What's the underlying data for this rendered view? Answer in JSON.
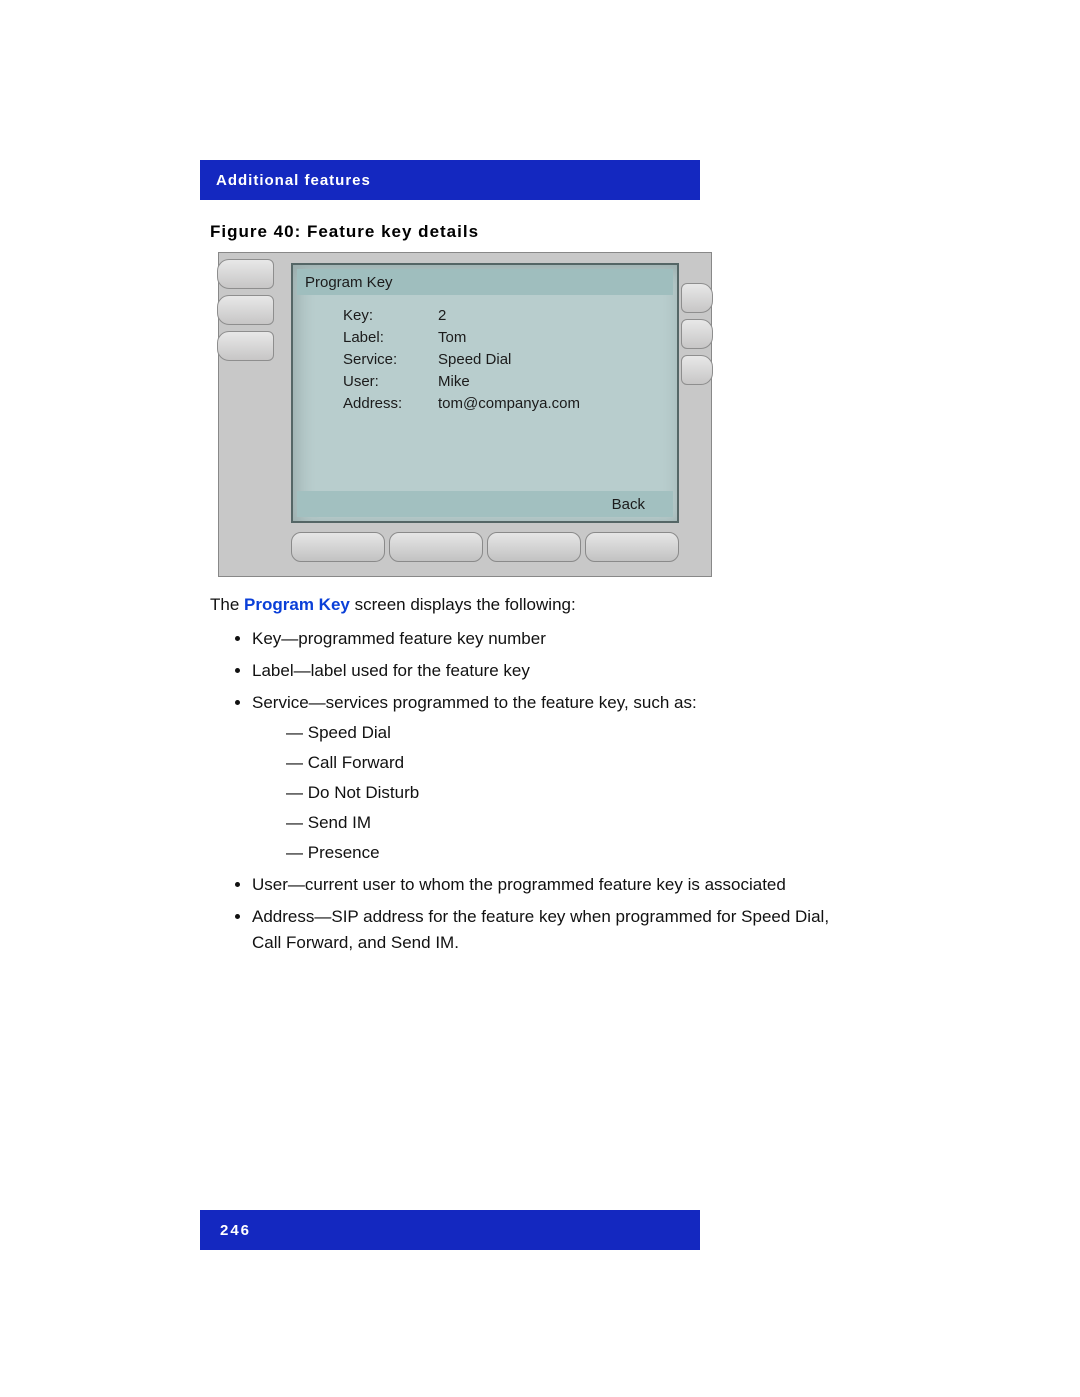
{
  "header": {
    "title": "Additional features"
  },
  "figure_caption": "Figure 40: Feature key details",
  "lcd": {
    "title": "Program Key",
    "rows": [
      {
        "label": "Key:",
        "value": "2"
      },
      {
        "label": "Label:",
        "value": "Tom"
      },
      {
        "label": "Service:",
        "value": "Speed Dial"
      },
      {
        "label": "User:",
        "value": "Mike"
      },
      {
        "label": "Address:",
        "value": "tom@companya.com"
      }
    ],
    "back_label": "Back"
  },
  "body": {
    "lead_pre": "The ",
    "lead_link": "Program Key",
    "lead_post": " screen displays the following:",
    "items": [
      "Key—programmed feature key number",
      "Label—label used for the feature key"
    ],
    "service_item": "Service—services programmed to the feature key, such as:",
    "service_sub": [
      "Speed Dial",
      "Call Forward",
      "Do Not Disturb",
      "Send IM",
      "Presence"
    ],
    "items_after": [
      "User—current user to whom the programmed feature key is associated",
      "Address—SIP address for the feature key when programmed for Speed Dial, Call Forward, and Send IM."
    ]
  },
  "footer": {
    "page_number": "246"
  }
}
